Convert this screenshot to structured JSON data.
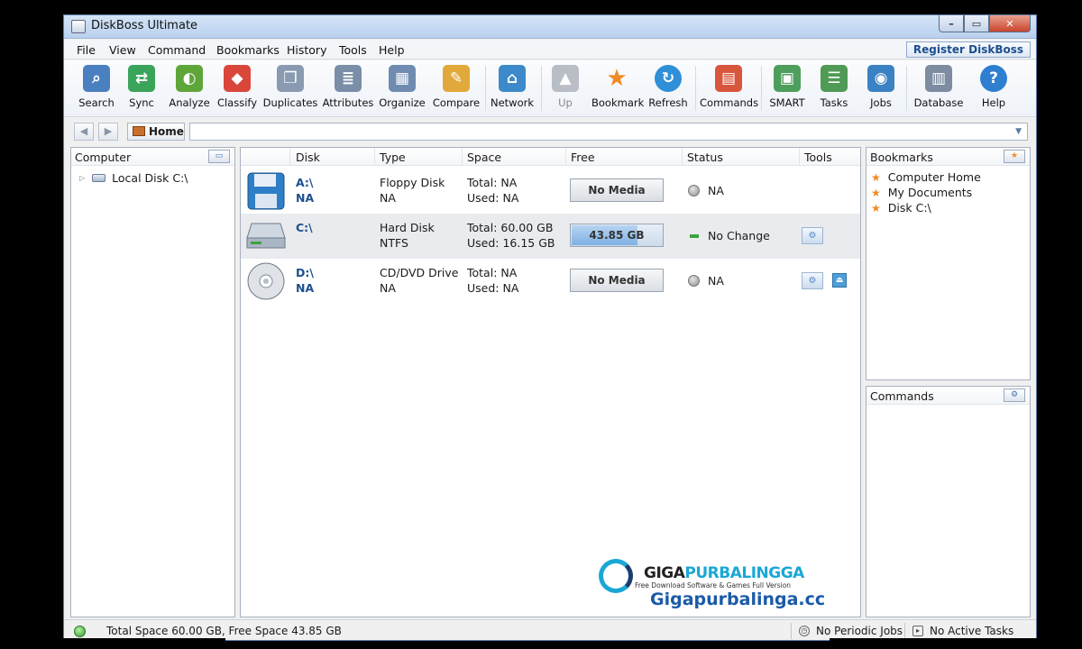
{
  "window": {
    "title": "DiskBoss Ultimate"
  },
  "menu": {
    "items": [
      "File",
      "View",
      "Command",
      "Bookmarks",
      "History",
      "Tools",
      "Help"
    ],
    "register": "Register DiskBoss"
  },
  "toolbar": {
    "buttons": [
      {
        "label": "Search",
        "icon": "search-icon",
        "color": "#4a7fc0"
      },
      {
        "label": "Sync",
        "icon": "sync-icon",
        "color": "#3aa45a"
      },
      {
        "label": "Analyze",
        "icon": "analyze-icon",
        "color": "#5fa63a"
      },
      {
        "label": "Classify",
        "icon": "classify-icon",
        "color": "#d9473b"
      },
      {
        "label": "Duplicates",
        "icon": "duplicates-icon",
        "color": "#8a9ab0"
      },
      {
        "label": "Attributes",
        "icon": "attributes-icon",
        "color": "#7b8ea8"
      },
      {
        "label": "Organize",
        "icon": "organize-icon",
        "color": "#6f8bb0"
      },
      {
        "label": "Compare",
        "icon": "compare-icon",
        "color": "#e0a93a"
      },
      {
        "label": "Network",
        "icon": "network-icon",
        "color": "#3c8ac9"
      },
      {
        "label": "Up",
        "icon": "up-arrow-icon",
        "color": "#b9bec6"
      },
      {
        "label": "Bookmark",
        "icon": "star-icon",
        "color": "#f08a24"
      },
      {
        "label": "Refresh",
        "icon": "refresh-icon",
        "color": "#2f8fd8"
      },
      {
        "label": "Commands",
        "icon": "commands-icon",
        "color": "#d8563c"
      },
      {
        "label": "SMART",
        "icon": "smart-icon",
        "color": "#4e9e5e"
      },
      {
        "label": "Tasks",
        "icon": "tasks-icon",
        "color": "#4f9a55"
      },
      {
        "label": "Jobs",
        "icon": "jobs-icon",
        "color": "#3b82c4"
      },
      {
        "label": "Database",
        "icon": "database-icon",
        "color": "#7d8ca0"
      },
      {
        "label": "Help",
        "icon": "help-icon",
        "color": "#2f7fd0"
      }
    ]
  },
  "address": {
    "home_label": "Home",
    "value": ""
  },
  "computer_panel": {
    "title": "Computer",
    "tree": [
      {
        "label": "Local Disk C:\\"
      }
    ]
  },
  "disks": {
    "columns": [
      "Disk",
      "Type",
      "Space",
      "Free",
      "Status",
      "Tools"
    ],
    "rows": [
      {
        "drive": "A:\\",
        "sub": "NA",
        "type": "Floppy Disk",
        "fs": "NA",
        "total": "Total: NA",
        "used": "Used: NA",
        "free": "No Media",
        "free_fraction": 0,
        "status": "NA",
        "icon": "floppy-disk-icon"
      },
      {
        "drive": "C:\\",
        "sub": "",
        "type": "Hard Disk",
        "fs": "NTFS",
        "total": "Total: 60.00 GB",
        "used": "Used: 16.15 GB",
        "free": "43.85 GB",
        "free_fraction": 0.73,
        "status": "No Change",
        "icon": "hard-disk-icon"
      },
      {
        "drive": "D:\\",
        "sub": "NA",
        "type": "CD/DVD Drive",
        "fs": "NA",
        "total": "Total: NA",
        "used": "Used: NA",
        "free": "No Media",
        "free_fraction": 0,
        "status": "NA",
        "icon": "cd-dvd-icon"
      }
    ]
  },
  "bookmarks_panel": {
    "title": "Bookmarks",
    "items": [
      "Computer Home",
      "My Documents",
      "Disk C:\\"
    ]
  },
  "commands_panel": {
    "title": "Commands"
  },
  "statusbar": {
    "space": "Total Space 60.00 GB, Free Space 43.85 GB",
    "jobs": "No Periodic Jobs",
    "tasks": "No Active Tasks"
  },
  "watermark": {
    "brand_a": "GIGA",
    "brand_b": "PURBALINGGA",
    "tagline": "Free Download Software & Games Full Version",
    "url": "Gigapurbalinga.cc"
  }
}
